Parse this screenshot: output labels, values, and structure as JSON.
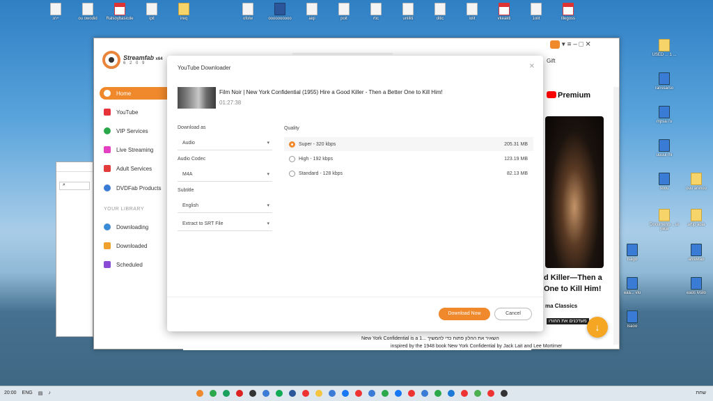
{
  "desktop": {
    "top_icons": [
      {
        "label": "ייחנ"
      },
      {
        "label": "ou owodid"
      },
      {
        "label": "Ralsoybasicde"
      },
      {
        "label": "ipit"
      },
      {
        "label": "ireq"
      },
      {
        "label": "ofolw"
      },
      {
        "label": "oooooooooo"
      },
      {
        "label": "aiqi"
      },
      {
        "label": "poit"
      },
      {
        "label": "rtic"
      },
      {
        "label": "unliliti"
      },
      {
        "label": "ditic"
      },
      {
        "label": "iolit"
      },
      {
        "label": "vkeakti"
      },
      {
        "label": "1olit"
      },
      {
        "label": "lllegoss"
      }
    ],
    "right_icons": [
      {
        "label": "USED ... 1 ..."
      },
      {
        "label": "ranssarso"
      },
      {
        "label": "mpsa i'u"
      },
      {
        "label": "uuuui mi"
      },
      {
        "label": "soou"
      },
      {
        "label": "ouu aninou"
      },
      {
        "label": "Documents ...ul yaija"
      },
      {
        "label": "artip aoia"
      },
      {
        "label": "lsago"
      },
      {
        "label": "ariswrao"
      },
      {
        "label": "eaa... viu"
      },
      {
        "label": "eaos ivsilo"
      },
      {
        "label": "isaoo"
      }
    ]
  },
  "browser": {
    "gift": "Gift",
    "premium": "Premium",
    "video_title": "d Killer—Then a One to Kill Him!",
    "classics": "ma Classics",
    "hebrew_caption": "מעדכנים את ההורו",
    "bottom_line1": "New York Confidential is a 1... השאיר את ההלון פתוח כדי להמשיך",
    "bottom_line2": "inspired by the 1948 book New York Confidential by Jack Lait and Lee Mortimer"
  },
  "app": {
    "brand": "Streamfab",
    "brand_suffix": "x64",
    "version": "6 2 0 9",
    "nav": [
      {
        "label": "Home",
        "active": true,
        "color": "#f0882c"
      },
      {
        "label": "YouTube",
        "active": false,
        "color": "#e8333a"
      },
      {
        "label": "VIP Services",
        "active": false,
        "color": "#2aa84a"
      },
      {
        "label": "Live Streaming",
        "active": false,
        "color": "#e33fc0"
      },
      {
        "label": "Adult Services",
        "active": false,
        "color": "#e33a3a"
      },
      {
        "label": "DVDFab Products",
        "active": false,
        "color": "#3a7bd5"
      }
    ],
    "library_title": "YOUR LIBRARY",
    "library": [
      {
        "label": "Downloading",
        "color": "#3a8bd5"
      },
      {
        "label": "Downloaded",
        "color": "#f0a02c"
      },
      {
        "label": "Scheduled",
        "color": "#8a4ad5"
      }
    ]
  },
  "dialog": {
    "title": "YouTube Downloader",
    "video_title": "Film Noir | New York Confidential (1955) Hire a Good Killer - Then a Better One to Kill Him!",
    "duration": "01:27:38",
    "download_as_label": "Download as",
    "download_as_value": "Audio",
    "codec_label": "Audio Codec",
    "codec_value": "M4A",
    "subtitle_label": "Subtitle",
    "subtitle_value": "English",
    "subtitle_extract": "Extract to SRT File",
    "quality_label": "Quality",
    "qualities": [
      {
        "label": "Super - 320 kbps",
        "size": "205.31 MB",
        "selected": true
      },
      {
        "label": "High - 192 kbps",
        "size": "123.19 MB",
        "selected": false
      },
      {
        "label": "Standard - 128 kbps",
        "size": "82.13 MB",
        "selected": false
      }
    ],
    "download_btn": "Download Now",
    "cancel_btn": "Cancel"
  },
  "taskbar": {
    "time": "20:00",
    "lang": "ENG",
    "right_text": "שחת"
  }
}
